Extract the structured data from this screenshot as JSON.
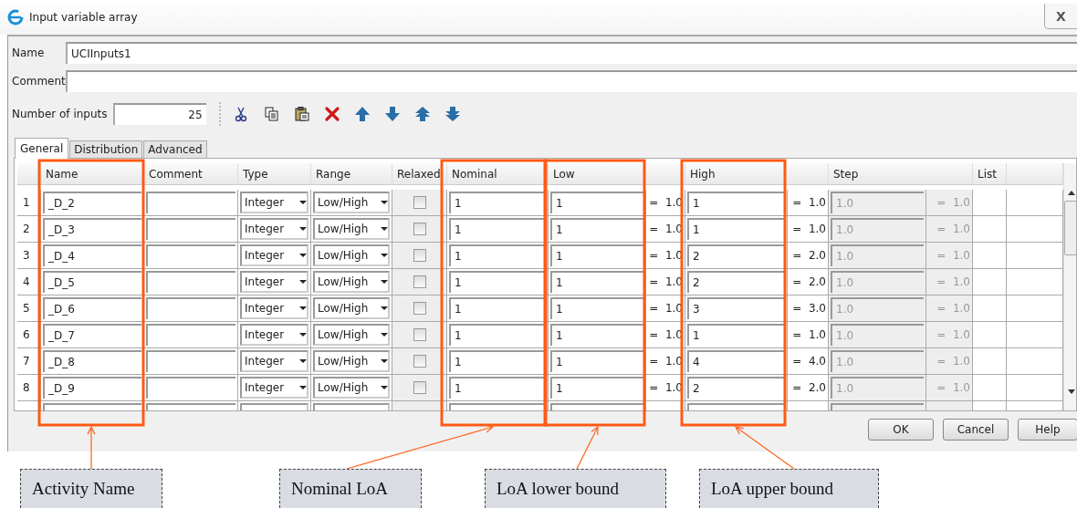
{
  "window": {
    "title": "Input variable array",
    "close_label": "X"
  },
  "name_field": {
    "label": "Name",
    "value": "UCIInputs1"
  },
  "comment_field": {
    "label": "Comment"
  },
  "number_of_inputs": {
    "label": "Number of inputs",
    "value": "25"
  },
  "tabs": [
    {
      "label": "General",
      "selected": true
    },
    {
      "label": "Distribution",
      "selected": false
    },
    {
      "label": "Advanced",
      "selected": false
    }
  ],
  "table": {
    "columns": [
      "Name",
      "Comment",
      "Type",
      "Range",
      "Relaxed",
      "Nominal",
      "Low",
      "High",
      "Step",
      "List"
    ],
    "rows": [
      {
        "index": "1",
        "name": "_D_2",
        "type": "Integer",
        "range": "Low/High",
        "relaxed": false,
        "nominal": "1",
        "low": "1",
        "low_result": "= 1.0",
        "high": "1",
        "high_result": "= 1.0",
        "step": "1.0",
        "step_result": "= 1.0",
        "step_disabled": true
      },
      {
        "index": "2",
        "name": "_D_3",
        "type": "Integer",
        "range": "Low/High",
        "relaxed": false,
        "nominal": "1",
        "low": "1",
        "low_result": "= 1.0",
        "high": "1",
        "high_result": "= 1.0",
        "step": "1.0",
        "step_result": "= 1.0",
        "step_disabled": true
      },
      {
        "index": "3",
        "name": "_D_4",
        "type": "Integer",
        "range": "Low/High",
        "relaxed": false,
        "nominal": "1",
        "low": "1",
        "low_result": "= 1.0",
        "high": "2",
        "high_result": "= 2.0",
        "step": "1.0",
        "step_result": "= 1.0",
        "step_disabled": true
      },
      {
        "index": "4",
        "name": "_D_5",
        "type": "Integer",
        "range": "Low/High",
        "relaxed": false,
        "nominal": "1",
        "low": "1",
        "low_result": "= 1.0",
        "high": "2",
        "high_result": "= 2.0",
        "step": "1.0",
        "step_result": "= 1.0",
        "step_disabled": true
      },
      {
        "index": "5",
        "name": "_D_6",
        "type": "Integer",
        "range": "Low/High",
        "relaxed": false,
        "nominal": "1",
        "low": "1",
        "low_result": "= 1.0",
        "high": "3",
        "high_result": "= 3.0",
        "step": "1.0",
        "step_result": "= 1.0",
        "step_disabled": true
      },
      {
        "index": "6",
        "name": "_D_7",
        "type": "Integer",
        "range": "Low/High",
        "relaxed": false,
        "nominal": "1",
        "low": "1",
        "low_result": "= 1.0",
        "high": "1",
        "high_result": "= 1.0",
        "step": "1.0",
        "step_result": "= 1.0",
        "step_disabled": true
      },
      {
        "index": "7",
        "name": "_D_8",
        "type": "Integer",
        "range": "Low/High",
        "relaxed": false,
        "nominal": "1",
        "low": "1",
        "low_result": "= 1.0",
        "high": "4",
        "high_result": "= 4.0",
        "step": "1.0",
        "step_result": "= 1.0",
        "step_disabled": true
      },
      {
        "index": "8",
        "name": "_D_9",
        "type": "Integer",
        "range": "Low/High",
        "relaxed": false,
        "nominal": "1",
        "low": "1",
        "low_result": "= 1.0",
        "high": "2",
        "high_result": "= 2.0",
        "step": "1.0",
        "step_result": "= 1.0",
        "step_disabled": true
      }
    ]
  },
  "buttons": [
    "OK",
    "Cancel",
    "Help"
  ],
  "annotations": [
    {
      "label": "Activity Name"
    },
    {
      "label": "Nominal LoA"
    },
    {
      "label": "LoA lower bound"
    },
    {
      "label": "LoA upper bound"
    }
  ]
}
